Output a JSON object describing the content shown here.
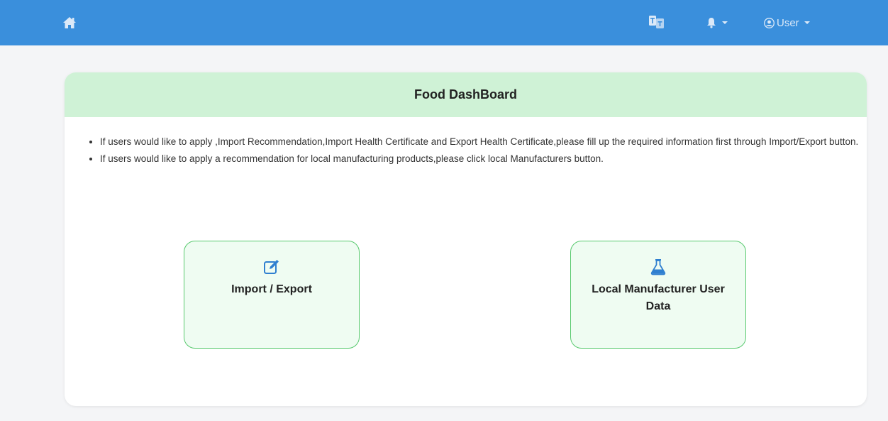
{
  "navbar": {
    "home_icon": "home-icon",
    "lang_icon": "language-icon",
    "bell_icon": "bell-icon",
    "user_icon": "user-circle-icon",
    "user_label": "User",
    "background": "#3a8fdc"
  },
  "dashboard": {
    "title": "Food DashBoard",
    "header_color": "#cff2d6",
    "instructions": [
      "If users would like to apply ,Import Recommendation,Import Health Certificate and Export Health Certificate,please fill up the required information first through Import/Export button.",
      "If users would like to apply a recommendation for local manufacturing products,please click local Manufacturers button."
    ],
    "buttons": [
      {
        "label": "Import / Export",
        "icon": "edit-icon"
      },
      {
        "label": "Local Manufacturer User Data",
        "icon": "flask-icon"
      }
    ],
    "button_border_color": "#58c96e"
  }
}
